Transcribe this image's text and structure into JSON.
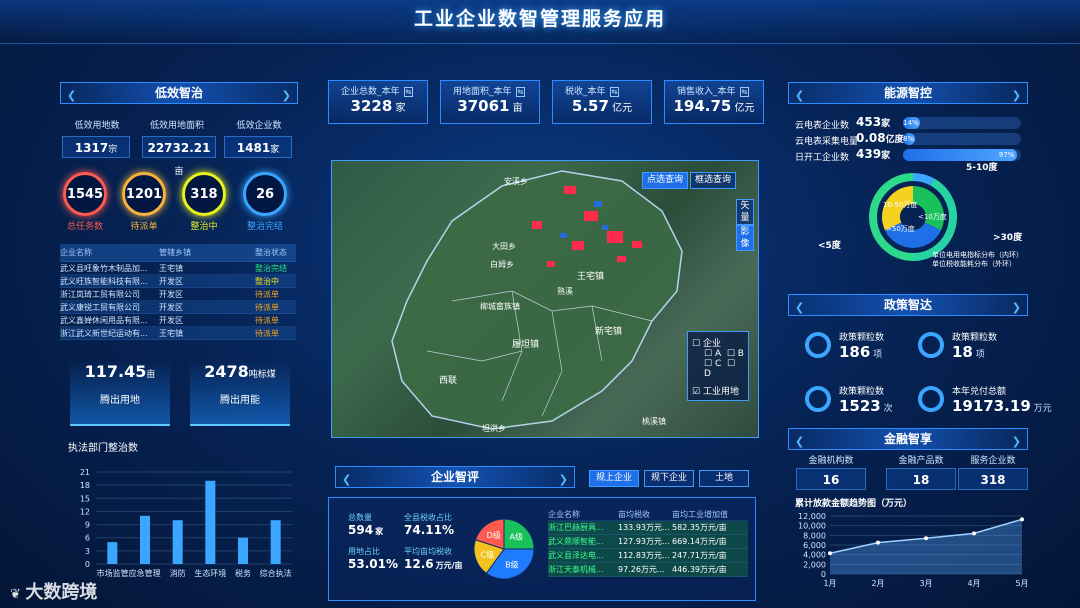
{
  "header": {
    "title": "工业企业数智管理服务应用"
  },
  "left": {
    "section_title": "低效智治",
    "kpis": [
      {
        "label": "低效用地数",
        "value": "1317",
        "unit": "宗"
      },
      {
        "label": "低效用地面积",
        "value": "22732.21",
        "unit": "亩"
      },
      {
        "label": "低效企业数",
        "value": "1481",
        "unit": "家"
      }
    ],
    "rings": [
      {
        "value": "1545",
        "label": "总任务数",
        "color": "#ff5a4f"
      },
      {
        "value": "1201",
        "label": "待派单",
        "color": "#f7b23b"
      },
      {
        "value": "318",
        "label": "整治中",
        "color": "#e9f21a"
      },
      {
        "value": "26",
        "label": "整治完结",
        "color": "#3aa6ff"
      }
    ],
    "table": {
      "headers": [
        "企业名称",
        "管辖乡镇",
        "整治状态"
      ],
      "rows": [
        [
          "武义县旺象竹木制品加...",
          "王宅镇",
          "整治完结",
          "#29e07a"
        ],
        [
          "武义旺族智能科技有限...",
          "开发区",
          "整治中",
          "#f7e11d"
        ],
        [
          "浙江岚琦工贸有限公司",
          "开发区",
          "待派单",
          "#f7a51d"
        ],
        [
          "武义康锐工贸有限公司",
          "开发区",
          "待派单",
          "#f7a51d"
        ],
        [
          "武义鑫婵休闲用品有限...",
          "开发区",
          "待派单",
          "#f7a51d"
        ],
        [
          "浙江武义新世纪运动有...",
          "王宅镇",
          "待派单",
          "#f7a51d"
        ]
      ]
    },
    "platforms": [
      {
        "value": "117.45",
        "unit": "亩",
        "label": "腾出用地"
      },
      {
        "value": "2478",
        "unit": "吨标煤",
        "label": "腾出用能"
      }
    ],
    "chart_title": "执法部门整治数",
    "chart_data": {
      "type": "bar",
      "title": "执法部门整治数",
      "categories": [
        "市场监管",
        "应急管理",
        "消防",
        "生态环境",
        "税务",
        "综合执法"
      ],
      "visible_category_labels": [
        "市场监管应急管理",
        "消防",
        "生态环境",
        "税务",
        "综合执法"
      ],
      "values": [
        5,
        11,
        10,
        19,
        6,
        10
      ],
      "yticks": [
        0,
        3,
        6,
        9,
        12,
        15,
        18,
        21
      ],
      "ylim": [
        0,
        21
      ]
    }
  },
  "center": {
    "stats": [
      {
        "label": "企业总数_本年",
        "value": "3228",
        "unit": "家"
      },
      {
        "label": "用地面积_本年",
        "value": "37061",
        "unit": "亩"
      },
      {
        "label": "税收_本年",
        "value": "5.57",
        "unit": "亿元"
      },
      {
        "label": "销售收入_本年",
        "value": "194.75",
        "unit": "亿元"
      }
    ],
    "map": {
      "btn_point": "点选查询",
      "btn_box": "框选查询",
      "side_tabs": [
        "矢量",
        "影像"
      ],
      "towns": [
        "王宅镇",
        "履坦镇",
        "新宅镇",
        "西联",
        "柳城畲族镇",
        "熟溪",
        "白姆乡",
        "三港乡",
        "大田乡",
        "坦洪乡",
        "俞源乡",
        "桃溪镇",
        "安溪乡"
      ],
      "legend": {
        "enterprise": "企业",
        "grades": [
          "A",
          "B",
          "C",
          "D"
        ],
        "land": "工业用地"
      }
    },
    "eval": {
      "section_title": "企业智评",
      "tabs": [
        "规上企业",
        "规下企业",
        "土地"
      ],
      "metrics": [
        {
          "label": "总数量",
          "value": "594",
          "unit": "家"
        },
        {
          "label": "全县税收占比",
          "value": "74.11%",
          "unit": ""
        },
        {
          "label": "用地占比",
          "value": "53.01%",
          "unit": ""
        },
        {
          "label": "平均亩均税收",
          "value": "12.6",
          "unit": "万元/亩"
        }
      ],
      "pie": {
        "labels": [
          "A级",
          "B级",
          "C级",
          "D级"
        ],
        "values": [
          25,
          35,
          20,
          20
        ],
        "colors": [
          "#19c15a",
          "#1f7bff",
          "#f4c21f",
          "#ff5a4f"
        ]
      },
      "table": {
        "headers": [
          "企业名称",
          "亩均税收",
          "亩均工业增加值"
        ],
        "rows": [
          [
            "浙江巴赫厨具...",
            "133.93万元...",
            "582.35万元/亩"
          ],
          [
            "武义鼎顺智能...",
            "127.93万元...",
            "669.14万元/亩"
          ],
          [
            "武义县泽达电...",
            "112.83万元...",
            "247.71万元/亩"
          ],
          [
            "浙江天泰机械...",
            "97.26万元...",
            "446.39万元/亩"
          ]
        ]
      }
    }
  },
  "right": {
    "energy": {
      "section_title": "能源智控",
      "rows": [
        {
          "label": "云电表企业数",
          "value": "453",
          "unit": "家",
          "pct": "14%",
          "fill": 0.14
        },
        {
          "label": "云电表采集电量",
          "value": "0.08",
          "unit": "亿度",
          "pct": "8%",
          "fill": 0.08
        },
        {
          "label": "日开工企业数",
          "value": "439",
          "unit": "家",
          "pct": "97%",
          "fill": 0.97
        }
      ],
      "donut_labels": {
        "outer_top": "5-10度",
        "outer_right": ">30度",
        "outer_left": "<5度",
        "inner_a": "10-50万度",
        "inner_b": "<10万度",
        "inner_c": ">50万度"
      },
      "notes": [
        "单位电用电指标分布（内环）",
        "单位税收能耗分布（外环）"
      ]
    },
    "policy": {
      "section_title": "政策智达",
      "items": [
        {
          "label": "政策颗粒数",
          "value": "186",
          "unit": "项"
        },
        {
          "label": "政策颗粒数",
          "value": "18",
          "unit": "项"
        },
        {
          "label": "政策颗粒数",
          "value": "1523",
          "unit": "次"
        },
        {
          "label": "本年兑付总额",
          "value": "19173.19",
          "unit": "万元"
        }
      ]
    },
    "finance": {
      "section_title": "金融智享",
      "kpis": [
        {
          "label": "金融机构数",
          "value": "16"
        },
        {
          "label": "金融产品数",
          "value": "18"
        },
        {
          "label": "服务企业数",
          "value": "318"
        }
      ],
      "chart_title": "累计放款金额趋势图（万元）",
      "chart_data": {
        "type": "area",
        "title": "累计放款金额趋势图（万元）",
        "x": [
          "1月",
          "2月",
          "3月",
          "4月",
          "5月"
        ],
        "values": [
          4300,
          6500,
          7400,
          8400,
          11300
        ],
        "yticks": [
          0,
          2000,
          4000,
          6000,
          8000,
          10000,
          12000
        ],
        "ylim": [
          0,
          12000
        ]
      }
    }
  },
  "watermark": "大数跨境"
}
